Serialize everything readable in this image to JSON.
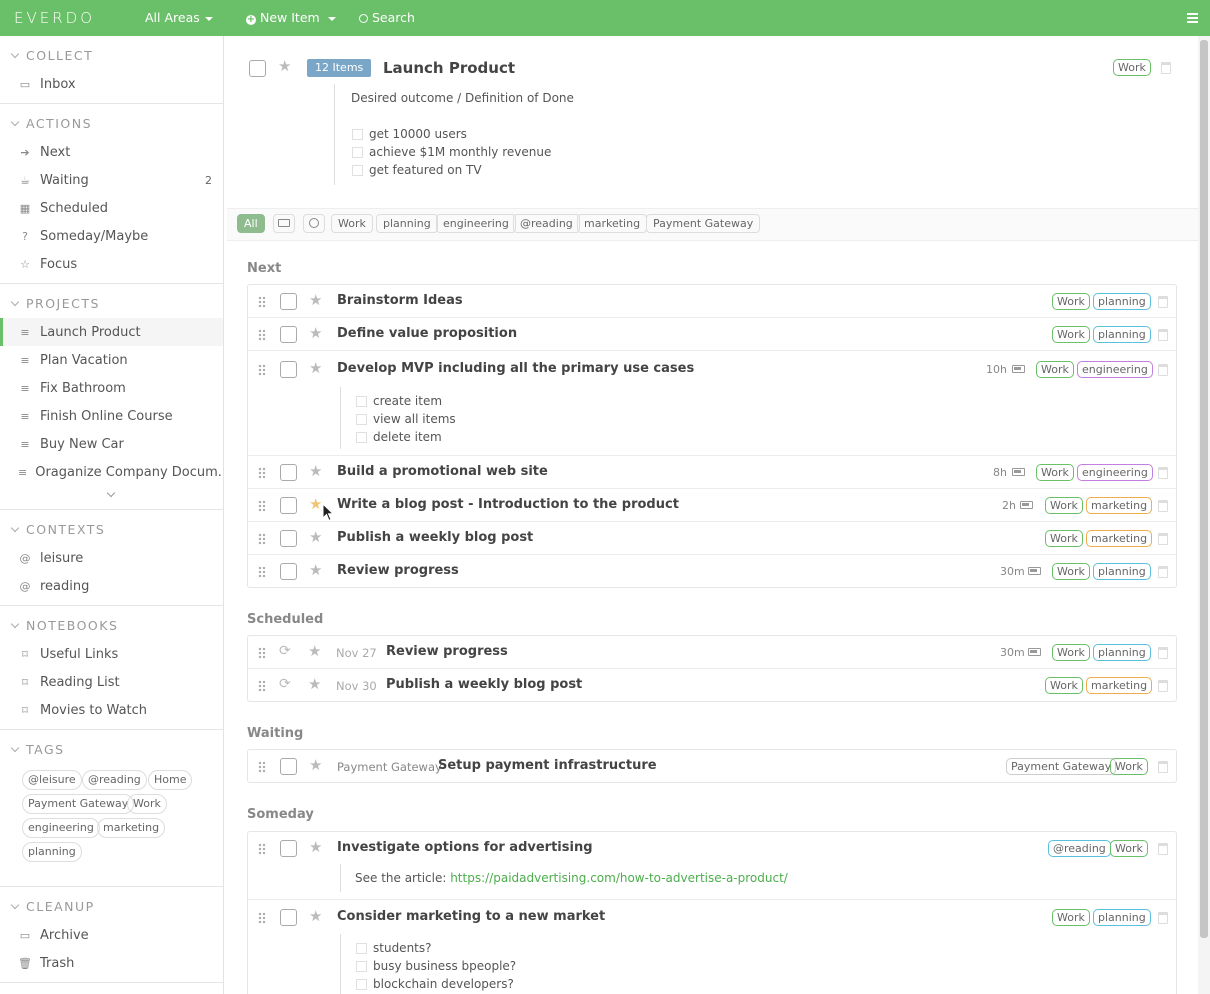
{
  "topbar": {
    "logo": "EVERDO",
    "areas": "All Areas",
    "new_item": "New Item",
    "search": "Search"
  },
  "sidebar": {
    "collect": {
      "title": "COLLECT",
      "items": [
        {
          "label": "Inbox"
        }
      ]
    },
    "actions": {
      "title": "ACTIONS",
      "items": [
        {
          "label": "Next"
        },
        {
          "label": "Waiting",
          "count": "2"
        },
        {
          "label": "Scheduled"
        },
        {
          "label": "Someday/Maybe"
        },
        {
          "label": "Focus"
        }
      ]
    },
    "projects": {
      "title": "PROJECTS",
      "items": [
        {
          "label": "Launch Product"
        },
        {
          "label": "Plan Vacation"
        },
        {
          "label": "Fix Bathroom"
        },
        {
          "label": "Finish Online Course"
        },
        {
          "label": "Buy New Car"
        },
        {
          "label": "Oraganize Company Docum..."
        }
      ]
    },
    "contexts": {
      "title": "CONTEXTS",
      "items": [
        {
          "label": "leisure"
        },
        {
          "label": "reading"
        }
      ]
    },
    "notebooks": {
      "title": "NOTEBOOKS",
      "items": [
        {
          "label": "Useful Links"
        },
        {
          "label": "Reading List"
        },
        {
          "label": "Movies to Watch"
        }
      ]
    },
    "tags": {
      "title": "TAGS",
      "items": [
        "@leisure",
        "@reading",
        "Home",
        "Payment Gateway",
        "Work",
        "engineering",
        "marketing",
        "planning"
      ]
    },
    "cleanup": {
      "title": "CLEANUP",
      "items": [
        {
          "label": "Archive"
        },
        {
          "label": "Trash"
        }
      ]
    }
  },
  "project": {
    "badge": "12 Items",
    "title": "Launch Product",
    "tag": "Work",
    "outcome_label": "Desired outcome / Definition of Done",
    "outcomes": [
      "get 10000 users",
      "achieve $1M monthly revenue",
      "get featured on TV"
    ]
  },
  "filters": [
    "All",
    "Work",
    "planning",
    "engineering",
    "@reading",
    "marketing",
    "Payment Gateway"
  ],
  "groups": {
    "next": "Next",
    "scheduled": "Scheduled",
    "waiting": "Waiting",
    "someday": "Someday"
  },
  "next": [
    {
      "title": "Brainstorm Ideas",
      "tags": [
        "Work",
        "planning"
      ]
    },
    {
      "title": "Define value proposition",
      "tags": [
        "Work",
        "planning"
      ]
    },
    {
      "title": "Develop MVP including all the primary use cases",
      "est": "10h",
      "tags": [
        "Work",
        "engineering"
      ],
      "subs": [
        "create item",
        "view all items",
        "delete item"
      ]
    },
    {
      "title": "Build a promotional web site",
      "est": "8h",
      "tags": [
        "Work",
        "engineering"
      ]
    },
    {
      "title": "Write a blog post - Introduction to the product",
      "est": "2h",
      "tags": [
        "Work",
        "marketing"
      ]
    },
    {
      "title": "Publish a weekly blog post",
      "tags": [
        "Work",
        "marketing"
      ]
    },
    {
      "title": "Review progress",
      "est": "30m",
      "tags": [
        "Work",
        "planning"
      ]
    }
  ],
  "scheduled": [
    {
      "date": "Nov 27",
      "title": "Review progress",
      "est": "30m",
      "tags": [
        "Work",
        "planning"
      ]
    },
    {
      "date": "Nov 30",
      "title": "Publish a weekly blog post",
      "tags": [
        "Work",
        "marketing"
      ]
    }
  ],
  "waiting": [
    {
      "context": "Payment Gateway",
      "title": "Setup payment infrastructure",
      "tags": [
        "Payment Gateway",
        "Work"
      ]
    }
  ],
  "someday": [
    {
      "title": "Investigate options for advertising",
      "tags": [
        "@reading",
        "Work"
      ],
      "note_prefix": "See the article: ",
      "note_link": "https://paidadvertising.com/how-to-advertise-a-product/"
    },
    {
      "title": "Consider marketing to a new market",
      "tags": [
        "Work",
        "planning"
      ],
      "subs": [
        "students?",
        "busy business bpeople?",
        "blockchain developers?"
      ]
    }
  ]
}
